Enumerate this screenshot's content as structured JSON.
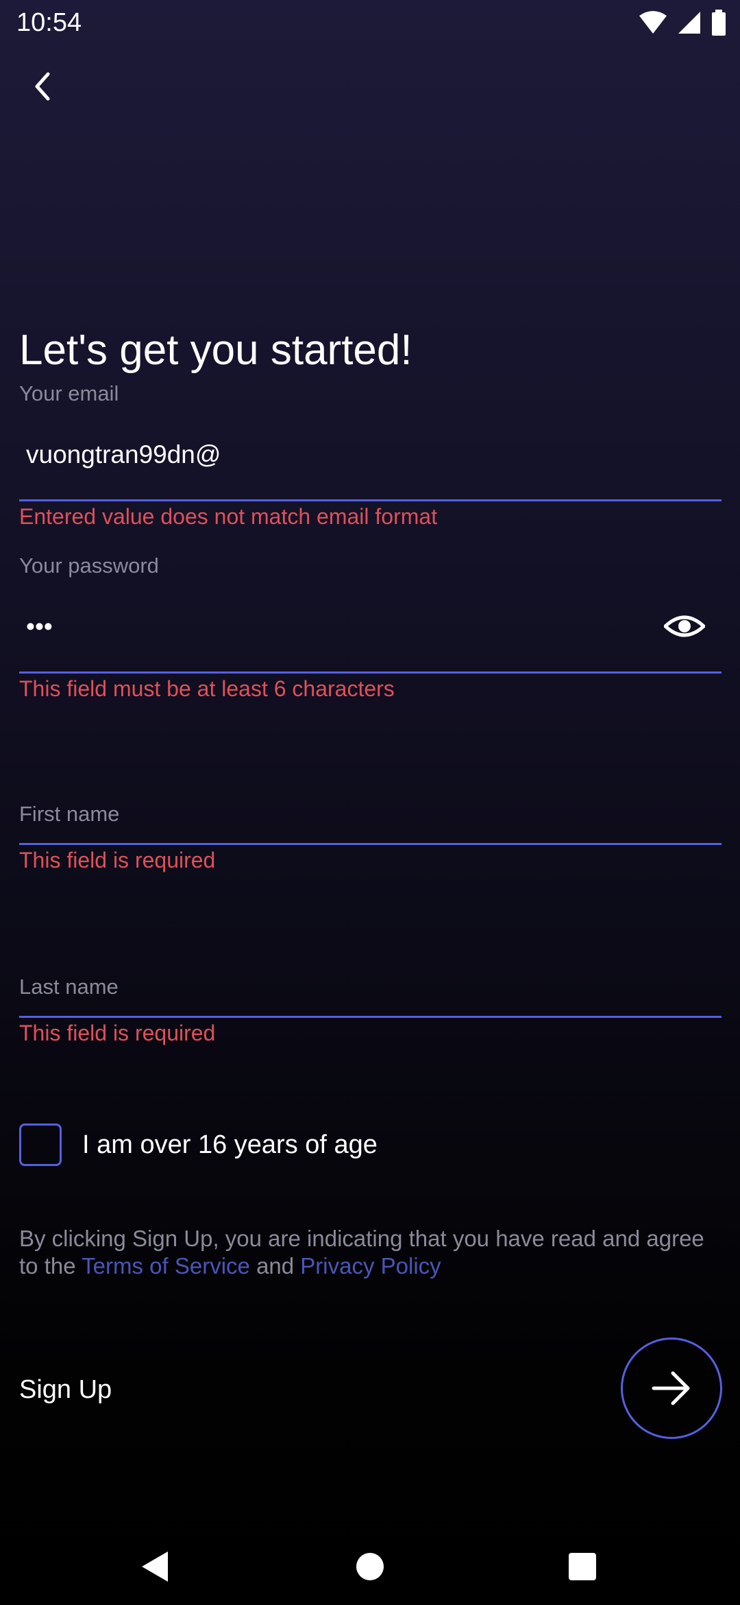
{
  "status_bar": {
    "time": "10:54",
    "icons": [
      "wifi-icon",
      "signal-icon",
      "battery-icon"
    ]
  },
  "header": {
    "back_icon": "chevron-left-icon"
  },
  "title": "Let's get you started!",
  "email": {
    "label": "Your email",
    "value": "vuongtran99dn@",
    "error": "Entered value does not match email format"
  },
  "password": {
    "label": "Your password",
    "value": "•••",
    "error": "This field must be at least 6 characters",
    "toggle_icon": "eye-icon"
  },
  "first_name": {
    "placeholder": "First name",
    "error": "This field is required"
  },
  "last_name": {
    "placeholder": "Last name",
    "error": "This field is required"
  },
  "age_check": {
    "label": "I am over 16 years of age",
    "checked": false
  },
  "terms": {
    "prefix": "By clicking Sign Up, you are indicating that you have read and agree to the",
    "tos": "Terms of Service",
    "and": "and",
    "privacy": "Privacy Policy"
  },
  "signup": {
    "label": "Sign Up",
    "icon": "arrow-right-icon"
  },
  "colors": {
    "accent": "#5560e0",
    "error": "#e0505a",
    "link": "#4a55b8",
    "muted": "#8b8a9a"
  },
  "nav": {
    "back": "back-triangle-icon",
    "home": "home-circle-icon",
    "recents": "recents-square-icon"
  }
}
